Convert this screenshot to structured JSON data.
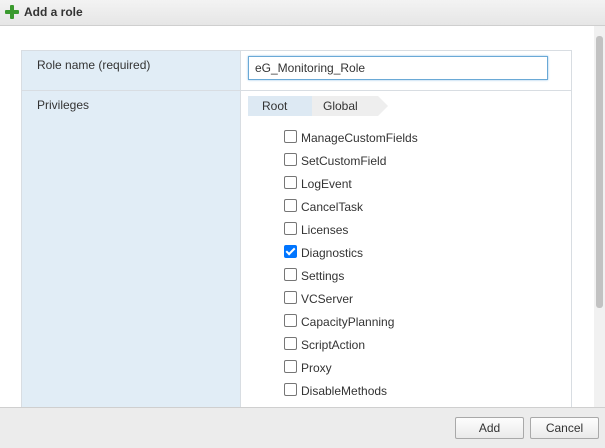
{
  "dialog": {
    "title": "Add a role",
    "title_icon": "plus-icon",
    "accent_color": "#3a9a2e"
  },
  "form": {
    "role_name_label": "Role name (required)",
    "role_name_value": "eG_Monitoring_Role",
    "privileges_label": "Privileges"
  },
  "breadcrumb": {
    "items": [
      "Root",
      "Global"
    ]
  },
  "privileges": [
    {
      "label": "ManageCustomFields",
      "checked": false
    },
    {
      "label": "SetCustomField",
      "checked": false
    },
    {
      "label": "LogEvent",
      "checked": false
    },
    {
      "label": "CancelTask",
      "checked": false
    },
    {
      "label": "Licenses",
      "checked": false
    },
    {
      "label": "Diagnostics",
      "checked": true
    },
    {
      "label": "Settings",
      "checked": false
    },
    {
      "label": "VCServer",
      "checked": false
    },
    {
      "label": "CapacityPlanning",
      "checked": false
    },
    {
      "label": "ScriptAction",
      "checked": false
    },
    {
      "label": "Proxy",
      "checked": false
    },
    {
      "label": "DisableMethods",
      "checked": false
    }
  ],
  "footer": {
    "add_label": "Add",
    "cancel_label": "Cancel"
  }
}
